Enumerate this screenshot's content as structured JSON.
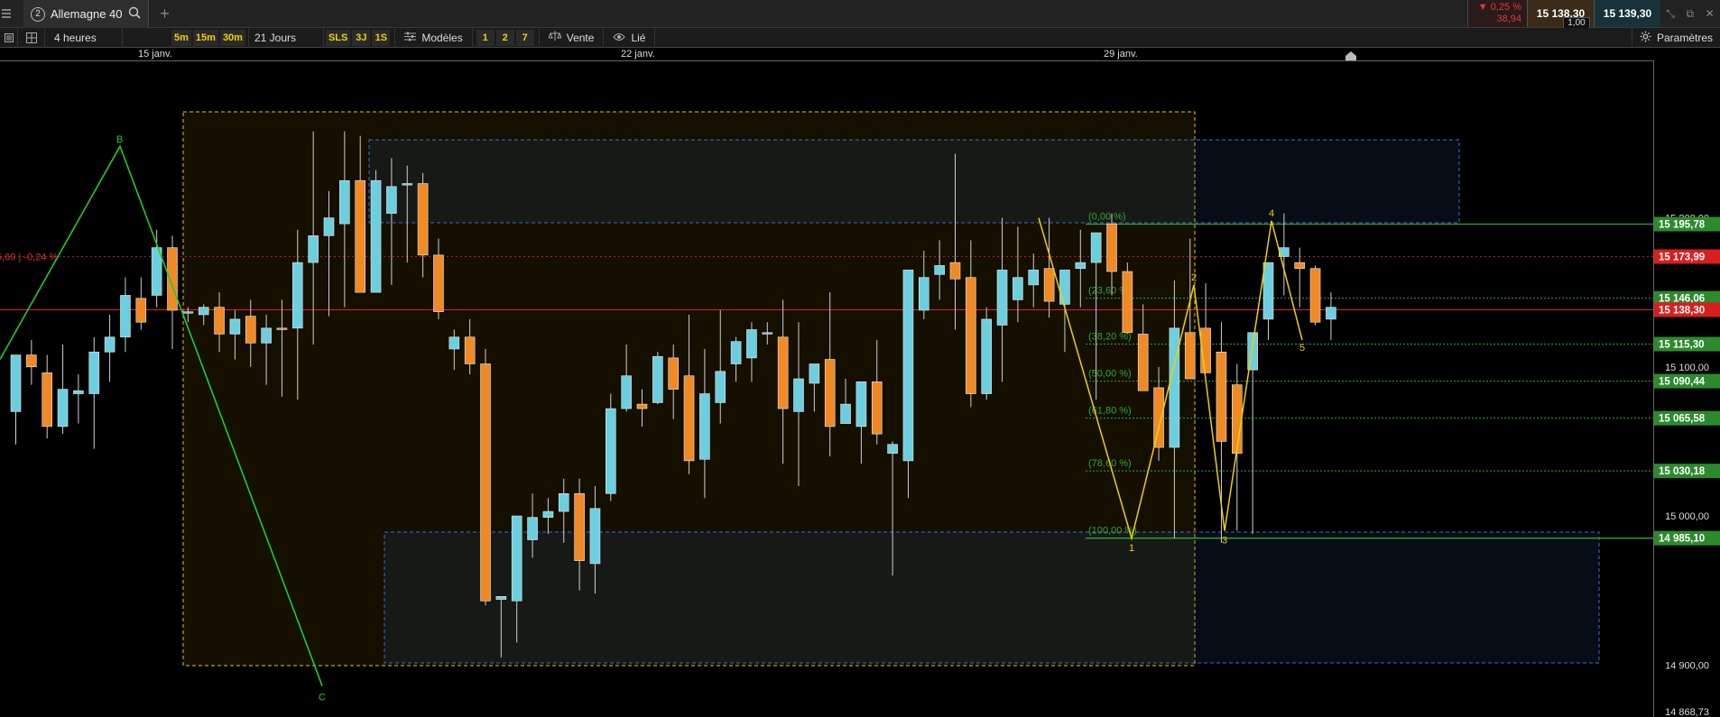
{
  "header": {
    "tab_number": "2",
    "tab_title": "Allemagne 40",
    "change_pct": "▼ 0,25 %",
    "change_abs": "38,94",
    "bid": "15 138,30",
    "ask": "15 139,30",
    "spread": "1,00"
  },
  "toolbar": {
    "period": "4 heures",
    "timeframes": [
      "5m",
      "15m",
      "30m"
    ],
    "range": "21 Jours",
    "quick_ranges": [
      "SLS",
      "3J",
      "1S"
    ],
    "models_label": "Modèles",
    "model_slots": [
      "1",
      "2",
      "7"
    ],
    "sell_label": "Vente",
    "linked_label": "Lié",
    "settings_label": "Paramètres"
  },
  "colors": {
    "bull": "#6ccfe0",
    "bear": "#f08a24",
    "last_price_line": "#e02020",
    "fib_green": "#2ea82e",
    "pattern_green": "#22cc22",
    "wave_yellow": "#f0d000"
  },
  "chart_data": {
    "type": "candlestick",
    "instrument": "Allemagne 40",
    "interval": "4 heures",
    "x_labels": [
      "15 janv.",
      "22 janv.",
      "29 janv."
    ],
    "ylim": [
      14868.73,
      15305
    ],
    "y_ticks": [
      "15 200,00",
      "15 100,00",
      "15 000,00",
      "14 900,00",
      "14 868,73"
    ],
    "price_labels": [
      {
        "text": "15 195,78",
        "value": 15195.78,
        "style": "green"
      },
      {
        "text": "15 173,99",
        "value": 15173.99,
        "style": "red"
      },
      {
        "text": "15 146,06",
        "value": 15146.06,
        "style": "green"
      },
      {
        "text": "15 138,30",
        "value": 15138.3,
        "style": "red"
      },
      {
        "text": "15 115,30",
        "value": 15115.3,
        "style": "green"
      },
      {
        "text": "15 090,44",
        "value": 15090.44,
        "style": "green"
      },
      {
        "text": "15 065,58",
        "value": 15065.58,
        "style": "green"
      },
      {
        "text": "15 030,18",
        "value": 15030.18,
        "style": "green"
      },
      {
        "text": "14 985,10",
        "value": 14985.1,
        "style": "green"
      }
    ],
    "last_price": 15138.3,
    "prev_close_label": "5,69 | -0,24 %",
    "prev_close": 15173.99,
    "fib_levels": [
      {
        "label": "(0,00 %)",
        "value": 15195.78
      },
      {
        "label": "(23,60 %)",
        "value": 15146.06
      },
      {
        "label": "(38,20 %)",
        "value": 15115.3
      },
      {
        "label": "(50,00 %)",
        "value": 15090.44
      },
      {
        "label": "(61,80 %)",
        "value": 15065.58
      },
      {
        "label": "(78,60 %)",
        "value": 15030.18
      },
      {
        "label": "(100,00 %)",
        "value": 14985.1
      }
    ],
    "candles": [
      {
        "o": 15070,
        "h": 15095,
        "l": 15048,
        "c": 15108
      },
      {
        "o": 15108,
        "h": 15118,
        "l": 15088,
        "c": 15100
      },
      {
        "o": 15096,
        "h": 15108,
        "l": 15052,
        "c": 15060
      },
      {
        "o": 15060,
        "h": 15115,
        "l": 15055,
        "c": 15085
      },
      {
        "o": 15082,
        "h": 15095,
        "l": 15062,
        "c": 15084
      },
      {
        "o": 15082,
        "h": 15120,
        "l": 15045,
        "c": 15110
      },
      {
        "o": 15110,
        "h": 15135,
        "l": 15090,
        "c": 15120
      },
      {
        "o": 15120,
        "h": 15160,
        "l": 15110,
        "c": 15148
      },
      {
        "o": 15146,
        "h": 15160,
        "l": 15125,
        "c": 15130
      },
      {
        "o": 15148,
        "h": 15192,
        "l": 15140,
        "c": 15180
      },
      {
        "o": 15180,
        "h": 15188,
        "l": 15112,
        "c": 15138
      },
      {
        "o": 15136,
        "h": 15140,
        "l": 15130,
        "c": 15137
      },
      {
        "o": 15135,
        "h": 15142,
        "l": 15128,
        "c": 15140
      },
      {
        "o": 15140,
        "h": 15150,
        "l": 15110,
        "c": 15122
      },
      {
        "o": 15122,
        "h": 15138,
        "l": 15105,
        "c": 15132
      },
      {
        "o": 15134,
        "h": 15145,
        "l": 15100,
        "c": 15116
      },
      {
        "o": 15116,
        "h": 15135,
        "l": 15088,
        "c": 15126
      },
      {
        "o": 15126,
        "h": 15145,
        "l": 15080,
        "c": 15125
      },
      {
        "o": 15126,
        "h": 15192,
        "l": 15078,
        "c": 15170
      },
      {
        "o": 15170,
        "h": 15258,
        "l": 15115,
        "c": 15188
      },
      {
        "o": 15188,
        "h": 15218,
        "l": 15134,
        "c": 15200
      },
      {
        "o": 15196,
        "h": 15258,
        "l": 15140,
        "c": 15225
      },
      {
        "o": 15225,
        "h": 15255,
        "l": 15172,
        "c": 15150
      },
      {
        "o": 15150,
        "h": 15232,
        "l": 15158,
        "c": 15225
      },
      {
        "o": 15203,
        "h": 15240,
        "l": 15155,
        "c": 15221
      },
      {
        "o": 15222,
        "h": 15235,
        "l": 15170,
        "c": 15223
      },
      {
        "o": 15223,
        "h": 15230,
        "l": 15160,
        "c": 15175
      },
      {
        "o": 15175,
        "h": 15186,
        "l": 15132,
        "c": 15137
      },
      {
        "o": 15112,
        "h": 15125,
        "l": 15098,
        "c": 15120
      },
      {
        "o": 15120,
        "h": 15132,
        "l": 15095,
        "c": 15102
      },
      {
        "o": 15102,
        "h": 15112,
        "l": 14940,
        "c": 14943
      },
      {
        "o": 14944,
        "h": 14946,
        "l": 14905,
        "c": 14946
      },
      {
        "o": 14943,
        "h": 14955,
        "l": 14915,
        "c": 15000
      },
      {
        "o": 14984,
        "h": 15015,
        "l": 14972,
        "c": 14999
      },
      {
        "o": 14999,
        "h": 15012,
        "l": 14988,
        "c": 15003
      },
      {
        "o": 15003,
        "h": 15025,
        "l": 14982,
        "c": 15015
      },
      {
        "o": 15015,
        "h": 15025,
        "l": 14950,
        "c": 14970
      },
      {
        "o": 14968,
        "h": 15020,
        "l": 14948,
        "c": 15005
      },
      {
        "o": 15015,
        "h": 15082,
        "l": 15010,
        "c": 15072
      },
      {
        "o": 15072,
        "h": 15115,
        "l": 15070,
        "c": 15094
      },
      {
        "o": 15075,
        "h": 15085,
        "l": 15060,
        "c": 15072
      },
      {
        "o": 15076,
        "h": 15110,
        "l": 15075,
        "c": 15107
      },
      {
        "o": 15106,
        "h": 15115,
        "l": 15065,
        "c": 15085
      },
      {
        "o": 15094,
        "h": 15135,
        "l": 15028,
        "c": 15037
      },
      {
        "o": 15038,
        "h": 15112,
        "l": 15012,
        "c": 15082
      },
      {
        "o": 15076,
        "h": 15138,
        "l": 15062,
        "c": 15097
      },
      {
        "o": 15102,
        "h": 15120,
        "l": 15090,
        "c": 15117
      },
      {
        "o": 15106,
        "h": 15130,
        "l": 15090,
        "c": 15125
      },
      {
        "o": 15122,
        "h": 15130,
        "l": 15115,
        "c": 15123
      },
      {
        "o": 15120,
        "h": 15145,
        "l": 15035,
        "c": 15072
      },
      {
        "o": 15070,
        "h": 15130,
        "l": 15020,
        "c": 15092
      },
      {
        "o": 15089,
        "h": 15100,
        "l": 15070,
        "c": 15102
      },
      {
        "o": 15105,
        "h": 15150,
        "l": 15040,
        "c": 15060
      },
      {
        "o": 15062,
        "h": 15092,
        "l": 15074,
        "c": 15075
      },
      {
        "o": 15060,
        "h": 15080,
        "l": 15035,
        "c": 15090
      },
      {
        "o": 15090,
        "h": 15118,
        "l": 15048,
        "c": 15055
      },
      {
        "o": 15042,
        "h": 15050,
        "l": 14960,
        "c": 15048
      },
      {
        "o": 15037,
        "h": 15070,
        "l": 15012,
        "c": 15165
      },
      {
        "o": 15138,
        "h": 15178,
        "l": 15132,
        "c": 15160
      },
      {
        "o": 15162,
        "h": 15185,
        "l": 15145,
        "c": 15168
      },
      {
        "o": 15170,
        "h": 15243,
        "l": 15125,
        "c": 15159
      },
      {
        "o": 15160,
        "h": 15185,
        "l": 15073,
        "c": 15082
      },
      {
        "o": 15082,
        "h": 15140,
        "l": 15078,
        "c": 15132
      },
      {
        "o": 15128,
        "h": 15200,
        "l": 15090,
        "c": 15165
      },
      {
        "o": 15145,
        "h": 15194,
        "l": 15130,
        "c": 15160
      },
      {
        "o": 15155,
        "h": 15176,
        "l": 15140,
        "c": 15165
      },
      {
        "o": 15166,
        "h": 15200,
        "l": 15133,
        "c": 15144
      },
      {
        "o": 15142,
        "h": 15152,
        "l": 15110,
        "c": 15165
      },
      {
        "o": 15166,
        "h": 15192,
        "l": 15140,
        "c": 15170
      },
      {
        "o": 15170,
        "h": 15180,
        "l": 15078,
        "c": 15190
      },
      {
        "o": 15196,
        "h": 15203,
        "l": 15148,
        "c": 15164
      },
      {
        "o": 15164,
        "h": 15170,
        "l": 15122,
        "c": 15123
      },
      {
        "o": 15122,
        "h": 15142,
        "l": 15112,
        "c": 15084
      },
      {
        "o": 15086,
        "h": 15100,
        "l": 15037,
        "c": 15046
      },
      {
        "o": 15046,
        "h": 15158,
        "l": 14985,
        "c": 15126
      },
      {
        "o": 15123,
        "h": 15186,
        "l": 15100,
        "c": 15092
      },
      {
        "o": 15126,
        "h": 15156,
        "l": 15103,
        "c": 15096
      },
      {
        "o": 15110,
        "h": 15130,
        "l": 14982,
        "c": 15050
      },
      {
        "o": 15088,
        "h": 15102,
        "l": 14990,
        "c": 15042
      },
      {
        "o": 15098,
        "h": 15112,
        "l": 14988,
        "c": 15123
      },
      {
        "o": 15132,
        "h": 15168,
        "l": 15118,
        "c": 15170
      },
      {
        "o": 15174,
        "h": 15203,
        "l": 15148,
        "c": 15180
      },
      {
        "o": 15170,
        "h": 15180,
        "l": 15140,
        "c": 15166
      },
      {
        "o": 15166,
        "h": 15168,
        "l": 15128,
        "c": 15130
      },
      {
        "o": 15132,
        "h": 15150,
        "l": 15118,
        "c": 15140
      }
    ],
    "harmonic_pattern": {
      "labels": [
        "B",
        "C"
      ],
      "values": [
        15248.0,
        14886.0
      ]
    },
    "wave_pattern": {
      "labels": [
        "1",
        "2",
        "3",
        "4",
        "5"
      ],
      "values": [
        14985.0,
        15155.0,
        14990.0,
        15198.0,
        15118.0
      ]
    },
    "zone_boxes": [
      "yellow-dashed",
      "blue-dashed-top",
      "blue-dashed-bottom"
    ]
  }
}
